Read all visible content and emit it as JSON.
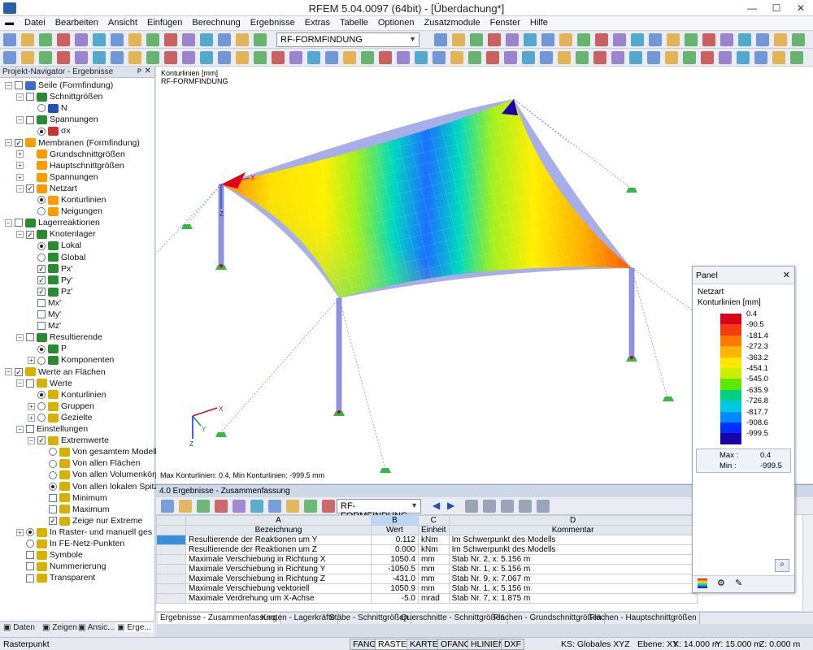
{
  "window": {
    "title": "RFEM 5.04.0097 (64bit) - [Überdachung*]"
  },
  "menu": [
    "Datei",
    "Bearbeiten",
    "Ansicht",
    "Einfügen",
    "Berechnung",
    "Ergebnisse",
    "Extras",
    "Tabelle",
    "Optionen",
    "Zusatzmodule",
    "Fenster",
    "Hilfe"
  ],
  "toolbar": {
    "case_select": "RF-FORMFINDUNG"
  },
  "navigator": {
    "title": "Projekt-Navigator - Ergebnisse",
    "items": [
      {
        "label": "Seile (Formfindung)"
      },
      {
        "label": "Schnittgrößen"
      },
      {
        "label": "N"
      },
      {
        "label": "Spannungen"
      },
      {
        "label": "σx"
      },
      {
        "label": "Membranen (Formfindung)"
      },
      {
        "label": "Grundschnittgrößen"
      },
      {
        "label": "Hauptschnittgrößen"
      },
      {
        "label": "Spannungen"
      },
      {
        "label": "Netzart"
      },
      {
        "label": "Konturlinien"
      },
      {
        "label": "Neigungen"
      },
      {
        "label": "Lagerreaktionen"
      },
      {
        "label": "Knotenlager"
      },
      {
        "label": "Lokal"
      },
      {
        "label": "Global"
      },
      {
        "label": "Px'"
      },
      {
        "label": "Py'"
      },
      {
        "label": "Pz'"
      },
      {
        "label": "Mx'"
      },
      {
        "label": "My'"
      },
      {
        "label": "Mz'"
      },
      {
        "label": "Resultierende"
      },
      {
        "label": "P"
      },
      {
        "label": "Komponenten"
      },
      {
        "label": "Werte an Flächen"
      },
      {
        "label": "Werte"
      },
      {
        "label": "Konturlinien"
      },
      {
        "label": "Gruppen"
      },
      {
        "label": "Gezielte"
      },
      {
        "label": "Einstellungen"
      },
      {
        "label": "Extremwerte"
      },
      {
        "label": "Von gesamtem Modell"
      },
      {
        "label": "Von allen Flächen"
      },
      {
        "label": "Von allen Volumenkörp"
      },
      {
        "label": "Von allen lokalen Spitz"
      },
      {
        "label": "Minimum"
      },
      {
        "label": "Maximum"
      },
      {
        "label": "Zeige nur Extreme"
      },
      {
        "label": "In Raster- und manuell ges"
      },
      {
        "label": "In FE-Netz-Punkten"
      },
      {
        "label": "Symbole"
      },
      {
        "label": "Nummerierung"
      },
      {
        "label": "Transparent"
      }
    ],
    "tabs": [
      "Daten",
      "Zeigen",
      "Ansic...",
      "Erge..."
    ]
  },
  "view": {
    "info_line1": "Konturlinien [mm]",
    "info_line2": "RF-FORMFINDUNG",
    "footer": "Max Konturlinien: 0.4, Min Konturlinien: -999.5 mm",
    "axis_x": "X",
    "axis_y": "Y",
    "axis_z": "Z"
  },
  "panel": {
    "title": "Panel",
    "section": "Netzart",
    "subsection": "Konturlinien [mm]",
    "legend_values": [
      "0.4",
      "-90.5",
      "-181.4",
      "-272.3",
      "-363.2",
      "-454.1",
      "-545.0",
      "-635.9",
      "-726.8",
      "-817.7",
      "-908.6",
      "-999.5"
    ],
    "legend_colors": [
      "#d9001a",
      "#f23b10",
      "#ff7a00",
      "#ffb400",
      "#ffe800",
      "#c8f000",
      "#5ee800",
      "#00d080",
      "#00c8e0",
      "#0088ff",
      "#0030ff",
      "#1a00a8"
    ],
    "max_label": "Max",
    "max_value": "0.4",
    "min_label": "Min",
    "min_value": "-999.5"
  },
  "results": {
    "title": "4.0 Ergebnisse - Zusammenfassung",
    "case_select": "RF-FORMFINDUNG",
    "col_letters": [
      "A",
      "B",
      "C",
      "D"
    ],
    "headers": [
      "Bezeichnung",
      "Wert",
      "Einheit",
      "Kommentar"
    ],
    "rows": [
      {
        "name": "Resultierende der Reaktionen um Y",
        "value": "0.112",
        "unit": "kNm",
        "comment": "Im Schwerpunkt des Modells"
      },
      {
        "name": "Resultierende der Reaktionen um Z",
        "value": "0.000",
        "unit": "kNm",
        "comment": "Im Schwerpunkt des Modells"
      },
      {
        "name": "Maximale Verschiebung in Richtung X",
        "value": "1050.4",
        "unit": "mm",
        "comment": "Stab Nr. 2, x: 5.156 m"
      },
      {
        "name": "Maximale Verschiebung in Richtung Y",
        "value": "-1050.5",
        "unit": "mm",
        "comment": "Stab Nr. 1, x: 5.156 m"
      },
      {
        "name": "Maximale Verschiebung in Richtung Z",
        "value": "-431.0",
        "unit": "mm",
        "comment": "Stab Nr. 9, x: 7.067 m"
      },
      {
        "name": "Maximale Verschiebung vektoriell",
        "value": "1050.9",
        "unit": "mm",
        "comment": "Stab Nr. 1, x: 5.156 m"
      },
      {
        "name": "Maximale Verdrehung um X-Achse",
        "value": "-5.0",
        "unit": "mrad",
        "comment": "Stab Nr. 7, x: 1.875 m"
      }
    ],
    "tabs": [
      "Ergebnisse - Zusammenfassung",
      "Knoten - Lagerkräfte",
      "Stäbe - Schnittgrößen",
      "Querschnitte - Schnittgrößen",
      "Flächen - Grundschnittgrößen",
      "Flächen - Hauptschnittgrößen"
    ]
  },
  "status": {
    "left": "Rasterpunkt",
    "buttons": [
      "FANG",
      "RASTER",
      "KARTES",
      "OFANG",
      "HLINIEN",
      "DXF"
    ],
    "ks": "KS: Globales XYZ",
    "ebene": "Ebene: XY",
    "x": "X:  14.000 m",
    "y": "Y:  15.000 m",
    "z": "Z:  0.000 m"
  }
}
